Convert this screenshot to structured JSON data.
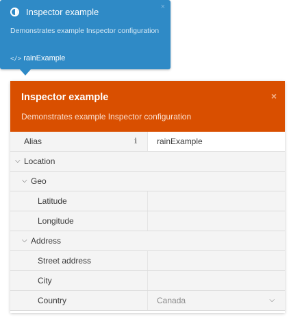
{
  "tooltip": {
    "title": "Inspector example",
    "description": "Demonstrates example Inspector configuration",
    "code_label": "rainExample",
    "close_glyph": "×",
    "code_glyph": "</>",
    "color": "#2f8ac6"
  },
  "inspector": {
    "title": "Inspector example",
    "description": "Demonstrates example Inspector configuration",
    "close_glyph": "×",
    "header_color": "#d94f00",
    "properties": {
      "alias": {
        "label": "Alias",
        "value": "rainExample",
        "info_glyph": "i"
      },
      "location": {
        "label": "Location",
        "geo": {
          "label": "Geo",
          "latitude": {
            "label": "Latitude",
            "value": ""
          },
          "longitude": {
            "label": "Longitude",
            "value": ""
          }
        },
        "address": {
          "label": "Address",
          "street": {
            "label": "Street address",
            "value": ""
          },
          "city": {
            "label": "City",
            "value": ""
          },
          "country": {
            "label": "Country",
            "value": "Canada"
          }
        }
      }
    }
  }
}
